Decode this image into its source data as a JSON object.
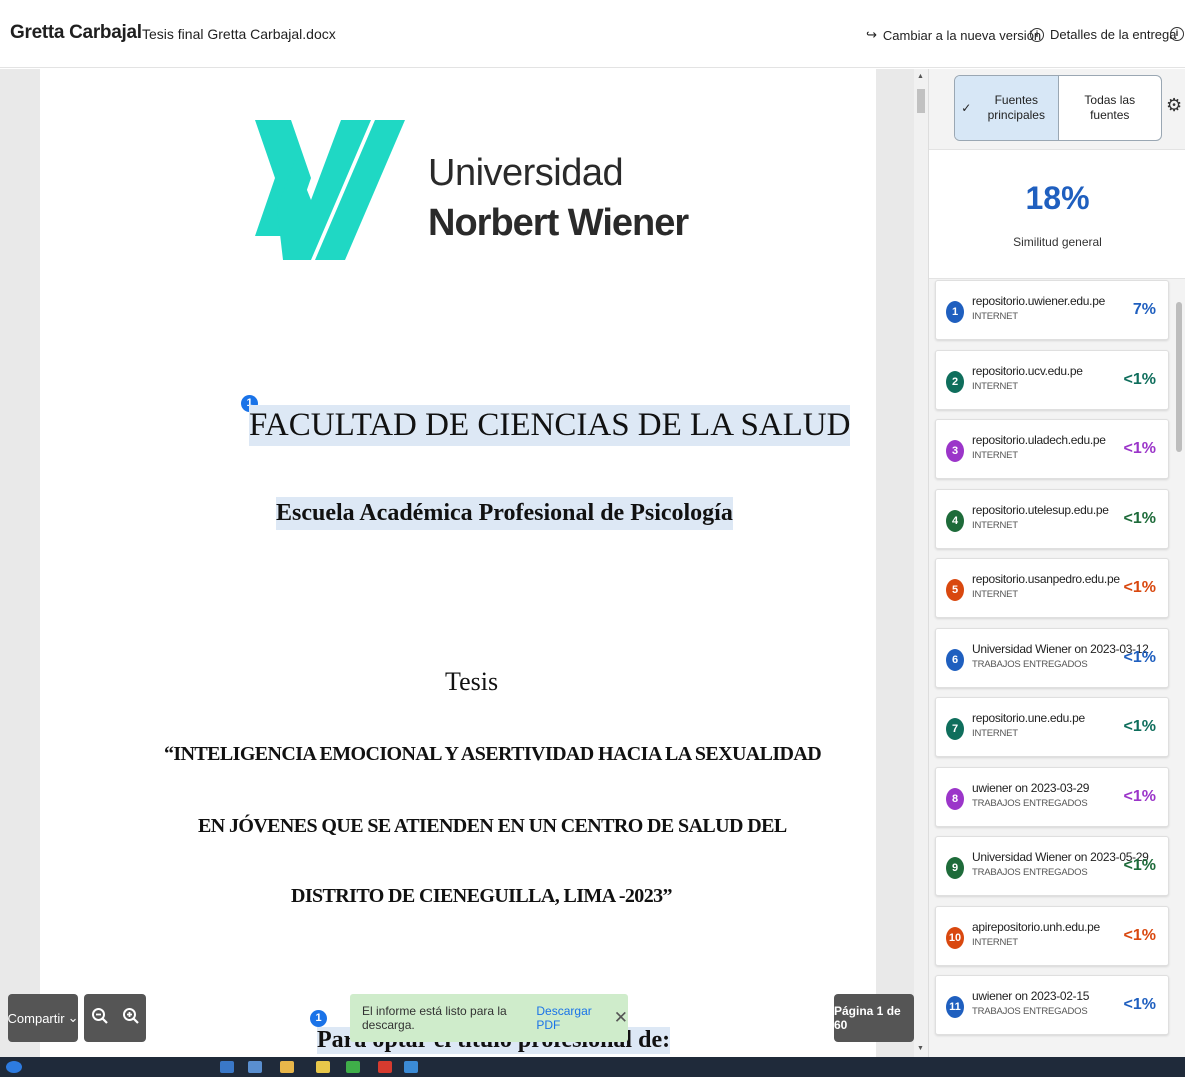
{
  "header": {
    "student": "Gretta Carbajal",
    "filename": "Tesis final Gretta Carbajal.docx",
    "switch_version": "Cambiar a la nueva versión",
    "submission_details": "Detalles de la entrega"
  },
  "document": {
    "logo_line1": "Universidad",
    "logo_line2": "Norbert Wiener",
    "faculty": "FACULTAD DE CIENCIAS DE LA SALUD",
    "school": "Escuela Académica Profesional de Psicología",
    "thesis_label": "Tesis",
    "title_line1": "“INTELIGENCIA EMOCIONAL Y ASERTIVIDAD HACIA LA SEXUALIDAD",
    "title_line2": "EN JÓVENES QUE SE ATIENDEN EN UN CENTRO DE SALUD DEL",
    "title_line3": "DISTRITO DE CIENEGUILLA, LIMA -2023”",
    "bottom_line": "Para optar el título profesional de:",
    "match_marker_1": "1",
    "match_marker_2": "1"
  },
  "controls": {
    "share": "Compartir",
    "toast_text": "El informe está listo para la descarga.",
    "toast_link": "Descargar PDF",
    "page_indicator": "Página 1 de 60"
  },
  "panel": {
    "tab_primary": "Fuentes principales",
    "tab_all": "Todas las fuentes",
    "score": "18%",
    "score_label": "Similitud general",
    "sources": [
      {
        "num": "1",
        "name": "repositorio.uwiener.edu.pe",
        "type": "INTERNET",
        "pct": "7%",
        "color": "#1f5fbf"
      },
      {
        "num": "2",
        "name": "repositorio.ucv.edu.pe",
        "type": "INTERNET",
        "pct": "<1%",
        "color": "#0f6e5c"
      },
      {
        "num": "3",
        "name": "repositorio.uladech.edu.pe",
        "type": "INTERNET",
        "pct": "<1%",
        "color": "#9b35c9"
      },
      {
        "num": "4",
        "name": "repositorio.utelesup.edu.pe",
        "type": "INTERNET",
        "pct": "<1%",
        "color": "#1e6b3a"
      },
      {
        "num": "5",
        "name": "repositorio.usanpedro.edu.pe",
        "type": "INTERNET",
        "pct": "<1%",
        "color": "#d9480f"
      },
      {
        "num": "6",
        "name": "Universidad Wiener on 2023-03-12",
        "type": "TRABAJOS ENTREGADOS",
        "pct": "<1%",
        "color": "#1f5fbf"
      },
      {
        "num": "7",
        "name": "repositorio.une.edu.pe",
        "type": "INTERNET",
        "pct": "<1%",
        "color": "#0f6e5c"
      },
      {
        "num": "8",
        "name": "uwiener on 2023-03-29",
        "type": "TRABAJOS ENTREGADOS",
        "pct": "<1%",
        "color": "#9b35c9"
      },
      {
        "num": "9",
        "name": "Universidad Wiener on 2023-05-29",
        "type": "TRABAJOS ENTREGADOS",
        "pct": "<1%",
        "color": "#1e6b3a"
      },
      {
        "num": "10",
        "name": "apirepositorio.unh.edu.pe",
        "type": "INTERNET",
        "pct": "<1%",
        "color": "#d9480f"
      },
      {
        "num": "11",
        "name": "uwiener on 2023-02-15",
        "type": "TRABAJOS ENTREGADOS",
        "pct": "<1%",
        "color": "#1f5fbf"
      }
    ]
  }
}
